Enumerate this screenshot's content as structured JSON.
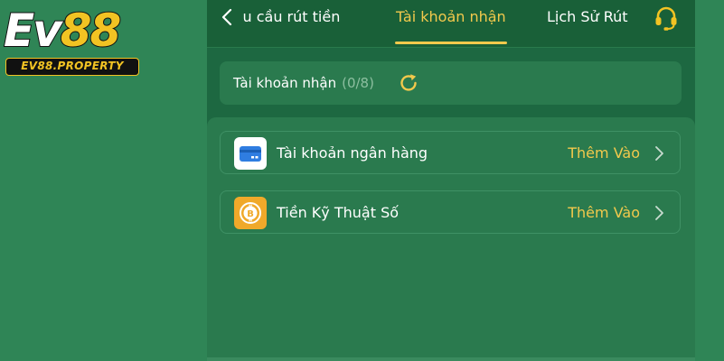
{
  "logo": {
    "word_prefix": "Ev",
    "word_number": "88",
    "domain": "EV88.PROPERTY"
  },
  "nav": {
    "tabs": [
      {
        "label": "Yêu cầu rút tiền",
        "visible_label": "u cầu rút tiền",
        "active": false
      },
      {
        "label": "Tài khoản nhận",
        "active": true
      },
      {
        "label": "Lịch Sử Rút",
        "active": false
      }
    ],
    "back_icon": "chevron-left-icon",
    "support_icon": "headset-icon"
  },
  "account_header": {
    "label": "Tài khoản nhận",
    "count": "(0/8)",
    "refresh_icon": "refresh-icon"
  },
  "options": [
    {
      "label": "Tài khoản ngân hàng",
      "action": "Thêm Vào",
      "icon": "bank-card-icon"
    },
    {
      "label": "Tiền Kỹ Thuật Số",
      "action": "Thêm Vào",
      "icon": "bitcoin-icon"
    }
  ],
  "colors": {
    "background": "#2f8556",
    "panel": "#1d6841",
    "card": "#2a7a4e",
    "accent": "#f2c94c",
    "logo_yellow": "#f2c323"
  }
}
